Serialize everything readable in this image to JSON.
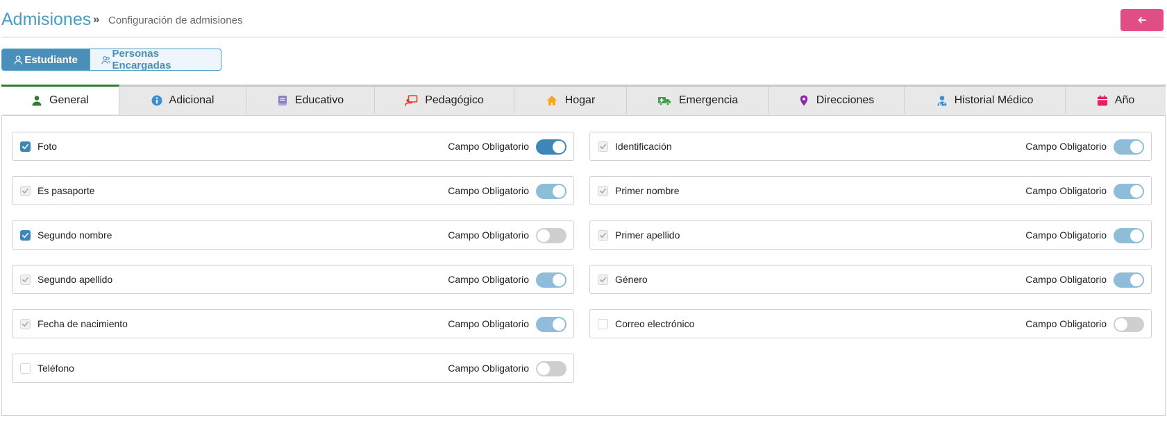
{
  "header": {
    "title": "Admisiones",
    "separator": "»",
    "breadcrumb": "Configuración de admisiones",
    "back_icon": "arrow-left-icon",
    "back_color": "#e14e85"
  },
  "segment": {
    "student_label": "Estudiante",
    "guardians_label": "Personas Encargadas"
  },
  "tabs": [
    {
      "label": "General",
      "icon": "person-icon",
      "color": "#2e7d32"
    },
    {
      "label": "Adicional",
      "icon": "info-icon",
      "color": "#3b8ed0"
    },
    {
      "label": "Educativo",
      "icon": "book-icon",
      "color": "#8a7cc6"
    },
    {
      "label": "Pedagógico",
      "icon": "presentation-icon",
      "color": "#e53935"
    },
    {
      "label": "Hogar",
      "icon": "home-icon",
      "color": "#f5a623"
    },
    {
      "label": "Emergencia",
      "icon": "ambulance-icon",
      "color": "#43a047"
    },
    {
      "label": "Direcciones",
      "icon": "map-pin-icon",
      "color": "#8e24aa"
    },
    {
      "label": "Historial Médico",
      "icon": "doctor-icon",
      "color": "#3b8ed0"
    },
    {
      "label": "Año",
      "icon": "calendar-icon",
      "color": "#e91e63"
    }
  ],
  "fields": {
    "required_label": "Campo Obligatorio",
    "left": [
      {
        "label": "Foto",
        "checkbox": "checked",
        "toggle": "on"
      },
      {
        "label": "Es pasaporte",
        "checkbox": "disabled",
        "toggle": "on-disabled"
      },
      {
        "label": "Segundo nombre",
        "checkbox": "checked",
        "toggle": "off"
      },
      {
        "label": "Segundo apellido",
        "checkbox": "disabled",
        "toggle": "on-disabled"
      },
      {
        "label": "Fecha de nacimiento",
        "checkbox": "disabled",
        "toggle": "on-disabled"
      },
      {
        "label": "Teléfono",
        "checkbox": "empty",
        "toggle": "off"
      }
    ],
    "right": [
      {
        "label": "Identificación",
        "checkbox": "disabled",
        "toggle": "on-disabled"
      },
      {
        "label": "Primer nombre",
        "checkbox": "disabled",
        "toggle": "on-disabled"
      },
      {
        "label": "Primer apellido",
        "checkbox": "disabled",
        "toggle": "on-disabled"
      },
      {
        "label": "Género",
        "checkbox": "disabled",
        "toggle": "on-disabled"
      },
      {
        "label": "Correo electrónico",
        "checkbox": "empty",
        "toggle": "off"
      }
    ]
  }
}
